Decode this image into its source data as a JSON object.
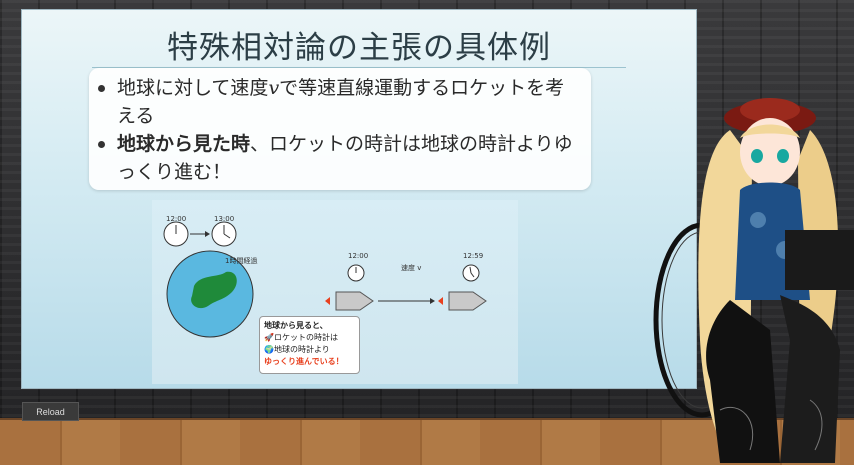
{
  "slide": {
    "title": "特殊相対論の主張の具体例",
    "bullets": {
      "b1_pre": "地球に対して速度",
      "b1_var": "v",
      "b1_post": "で等速直線運動するロケットを考える",
      "b2_bold": "地球から見た時",
      "b2_rest": "、ロケットの時計は地球の時計よりゆっくり進む！"
    }
  },
  "diagram": {
    "earth_clock_start": "12:00",
    "earth_clock_end": "13:00",
    "elapsed_label": "1時間経過",
    "rocket_clock_start": "12:00",
    "rocket_clock_end": "12:59",
    "speed_label": "速度 v",
    "callout": {
      "head": "地球から見ると、",
      "line1": "🚀ロケットの時計は",
      "line2": "🌍地球の時計より",
      "line3": "ゆっくり進んでいる！"
    }
  },
  "controls": {
    "reload_label": "Reload"
  },
  "colors": {
    "accent_red": "#e8411f",
    "earth_blue": "#5ab8e0",
    "land_green": "#1f8a3a"
  }
}
